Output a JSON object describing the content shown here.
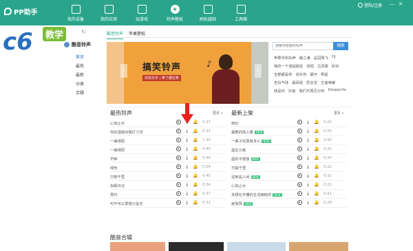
{
  "app": {
    "name": "PP助手",
    "login": "登陆/注册"
  },
  "nav": [
    {
      "label": "我的设备",
      "icon": "device-icon"
    },
    {
      "label": "我的应用",
      "icon": "apps-icon"
    },
    {
      "label": "玩游戏",
      "icon": "gamepad-icon"
    },
    {
      "label": "铃声壁纸",
      "icon": "star-icon"
    },
    {
      "label": "刷机越狱",
      "icon": "refresh-icon"
    },
    {
      "label": "工具箱",
      "icon": "toolbox-icon"
    }
  ],
  "watermark": {
    "brand": "c6",
    "label": "教学"
  },
  "tabs": [
    "酷音铃声",
    "苹果壁纸"
  ],
  "sidebar": {
    "title": "酷音铃声",
    "items": [
      "首页",
      "最热",
      "最新",
      "分类",
      "合辑"
    ]
  },
  "banner": {
    "title": "搞笑铃声",
    "subtitle": "欢欢乐乐 | 笑了都在笑"
  },
  "search": {
    "placeholder": "搜索你想要的铃声",
    "button": "搜索"
  },
  "tags": [
    [
      "苹果手机铃声",
      "薛之谦",
      "品冠周飞",
      "DJ"
    ],
    [
      "我的一个道姑朋友",
      "纸短",
      "古风歌",
      "彩铃"
    ],
    [
      "全部都是你",
      "说化你",
      "最可",
      "明星"
    ],
    [
      "告白气球",
      "最耳姐",
      "权志龙",
      "王者荣耀"
    ],
    [
      "我是你",
      "抖音",
      "我们不再见分你",
      "Despacito"
    ]
  ],
  "hot": {
    "title": "最热铃声",
    "more": "更多 »",
    "rows": [
      {
        "name": "心如止水",
        "dur": "0:27",
        "new": false
      },
      {
        "name": "你的酒馆对我打了烊",
        "dur": "0:33",
        "new": false
      },
      {
        "name": "一曲相思",
        "dur": "1:30",
        "new": false
      },
      {
        "name": "一曲相思",
        "dur": "0:40",
        "new": false
      },
      {
        "name": "芒种",
        "dur": "0:40",
        "new": false
      },
      {
        "name": "绿色",
        "dur": "0:54",
        "new": false
      },
      {
        "name": "万物千里",
        "dur": "0:45",
        "new": false
      },
      {
        "name": "失眠日记",
        "dur": "0:34",
        "new": false
      },
      {
        "name": "周刊",
        "dur": "0:37",
        "new": false
      },
      {
        "name": "可不可以爱情只是无",
        "dur": "0:32",
        "new": false
      }
    ]
  },
  "newest": {
    "title": "最新上架",
    "more": "更多 »",
    "new_label": "NEW",
    "rows": [
      {
        "name": "雨幻",
        "dur": "0:25",
        "new": false
      },
      {
        "name": "最惹的情人梗",
        "dur": "0:35",
        "new": true
      },
      {
        "name": "一辈子究竟有多久",
        "dur": "0:40",
        "new": true
      },
      {
        "name": "晨在江南",
        "dur": "0:32",
        "new": false
      },
      {
        "name": "晨的不想放",
        "dur": "0:35",
        "new": true
      },
      {
        "name": "万般千里",
        "dur": "0:22",
        "new": false
      },
      {
        "name": "这就是人间",
        "dur": "0:32",
        "new": true
      },
      {
        "name": "心如止水",
        "dur": "0:22",
        "new": false
      },
      {
        "name": "多想在平庸的生活拥抱你",
        "dur": "0:41",
        "new": true
      },
      {
        "name": "疫情赞",
        "dur": "0:28",
        "new": true
      }
    ]
  },
  "albums": {
    "title": "酷音合辑"
  },
  "colors": {
    "accent": "#2aa58c",
    "link": "#3b8fd9",
    "badge": "#34c07a"
  }
}
